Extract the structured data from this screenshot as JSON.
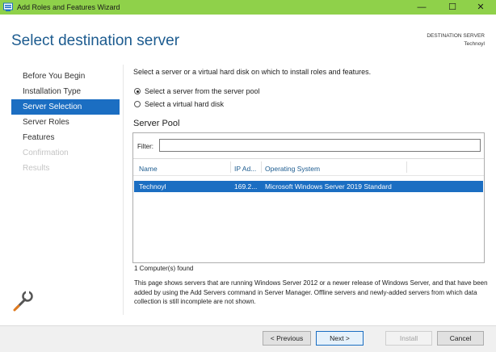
{
  "window": {
    "title": "Add Roles and Features Wizard",
    "controls": {
      "minimize": "—",
      "maximize": "☐",
      "close": "✕"
    },
    "titlebar_color": "#8fd14a"
  },
  "header": {
    "page_title": "Select destination server",
    "destination_label": "DESTINATION SERVER",
    "destination_value": "Technoyl"
  },
  "nav": {
    "items": [
      {
        "label": "Before You Begin",
        "state": "normal"
      },
      {
        "label": "Installation Type",
        "state": "normal"
      },
      {
        "label": "Server Selection",
        "state": "active"
      },
      {
        "label": "Server Roles",
        "state": "normal"
      },
      {
        "label": "Features",
        "state": "normal"
      },
      {
        "label": "Confirmation",
        "state": "disabled"
      },
      {
        "label": "Results",
        "state": "disabled"
      }
    ],
    "accent_color": "#1b6ec2"
  },
  "main": {
    "intro": "Select a server or a virtual hard disk on which to install roles and features.",
    "options": [
      {
        "label": "Select a server from the server pool",
        "checked": true
      },
      {
        "label": "Select a virtual hard disk",
        "checked": false
      }
    ],
    "pool": {
      "heading": "Server Pool",
      "filter_label": "Filter:",
      "filter_value": "",
      "columns": [
        "Name",
        "IP Ad...",
        "Operating System"
      ],
      "rows": [
        {
          "name": "Technoyl",
          "ip": "169.2...",
          "os": "Microsoft Windows Server 2019 Standard",
          "selected": true
        }
      ]
    },
    "found": "1 Computer(s) found",
    "description": "This page shows servers that are running Windows Server 2012 or a newer release of Windows Server, and that have been added by using the Add Servers command in Server Manager. Offline servers and newly-added servers from which data collection is still incomplete are not shown."
  },
  "footer": {
    "previous": "< Previous",
    "next": "Next >",
    "install": "Install",
    "cancel": "Cancel"
  }
}
